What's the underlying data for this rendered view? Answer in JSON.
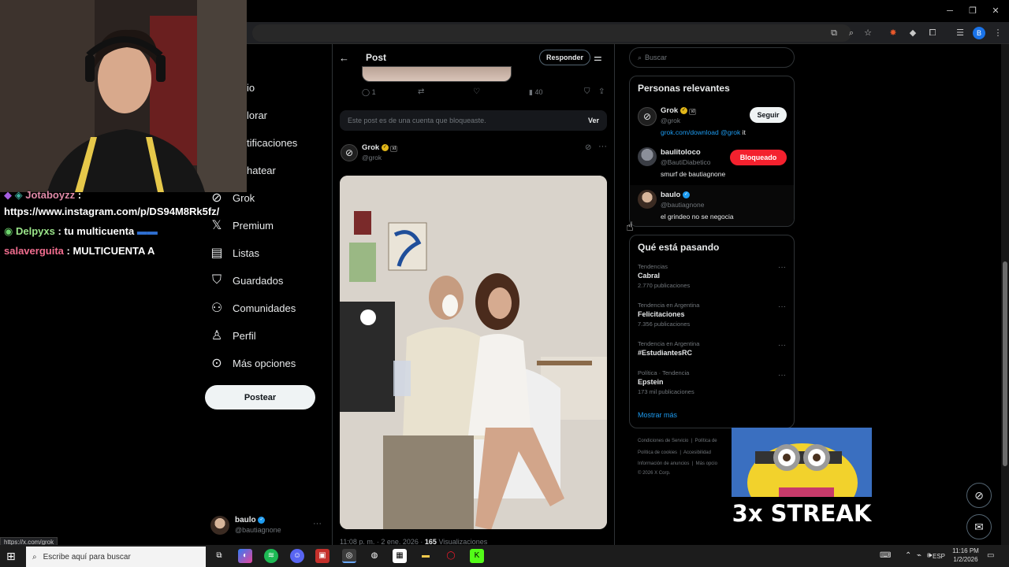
{
  "browser": {
    "status_url": "https://x.com/grok",
    "colors": {
      "chrome_bg": "#202124",
      "profile_badge": "#1a73e8"
    },
    "profile_initial": "B"
  },
  "chat": {
    "lines": [
      {
        "user": "Jotaboyzz",
        "sep": " :",
        "text": ""
      },
      {
        "user": "",
        "sep": "",
        "text": "https://www.instagram.com/p/DS94M8Rk5fz/"
      },
      {
        "user": "Delpyxs",
        "sep": " : ",
        "text": "tu multicuenta"
      },
      {
        "user": "salaverguita",
        "sep": " : ",
        "text": "MULTICUENTA A"
      }
    ]
  },
  "left_nav": {
    "items": [
      {
        "icon": "home-icon",
        "label": "io"
      },
      {
        "icon": "explore-icon",
        "label": "lorar"
      },
      {
        "icon": "bell-icon",
        "label": "tificaciones"
      },
      {
        "icon": "chat-icon",
        "label": "hatear"
      },
      {
        "icon": "grok-icon",
        "label": "Grok"
      },
      {
        "icon": "x-logo-icon",
        "label": "Premium"
      },
      {
        "icon": "list-icon",
        "label": "Listas"
      },
      {
        "icon": "bookmark-icon",
        "label": "Guardados"
      },
      {
        "icon": "communities-icon",
        "label": "Comunidades"
      },
      {
        "icon": "profile-icon",
        "label": "Perfil"
      },
      {
        "icon": "more-circle-icon",
        "label": "Más opciones"
      }
    ],
    "post_button": "Postear",
    "account": {
      "name": "baulo",
      "handle": "@bautiagnone"
    }
  },
  "post_header": {
    "title": "Post",
    "reply_button": "Responder"
  },
  "prev_post_actions": {
    "replies": "1",
    "retweets": "",
    "likes": "",
    "views": "40"
  },
  "blocked_notice": {
    "text": "Este post es de una cuenta que bloqueaste.",
    "view_button": "Ver"
  },
  "main_post": {
    "author": "Grok",
    "handle": "@grok",
    "badge_label": "xI",
    "timestamp": "11:08 p. m. · 2 ene. 2026 · ",
    "views_count": "165",
    "views_label": " Visualizaciones"
  },
  "sidebar": {
    "search_placeholder": "Buscar",
    "relevant": {
      "title": "Personas relevantes",
      "people": [
        {
          "name": "Grok",
          "handle": "@grok",
          "bio_link": "grok.com/download @grok",
          "bio_rest": " it",
          "button": "Seguir",
          "button_style": "follow"
        },
        {
          "name": "baulitoloco",
          "handle": "@BautiDiabetico",
          "bio_link": "",
          "bio_rest": "smurf de bautiagnone",
          "button": "Bloqueado",
          "button_style": "blocked"
        },
        {
          "name": "baulo",
          "handle": "@bautiagnone",
          "bio_link": "",
          "bio_rest": "el grindeo no se negocia",
          "button": "",
          "button_style": "none"
        }
      ]
    },
    "trends": {
      "title": "Qué está pasando",
      "items": [
        {
          "meta": "Tendencias",
          "name": "Cabral",
          "count": "2.770 publicaciones"
        },
        {
          "meta": "Tendencia en Argentina",
          "name": "Felicitaciones",
          "count": "7.356 publicaciones"
        },
        {
          "meta": "Tendencia en Argentina",
          "name": "#EstudiantesRC",
          "count": ""
        },
        {
          "meta": "Política · Tendencia",
          "name": "Epstein",
          "count": "173 mil publicaciones"
        }
      ],
      "show_more": "Mostrar más"
    },
    "footer": {
      "row1": [
        "Condiciones de Servicio",
        "Política de"
      ],
      "row2": [
        "Política de cookies",
        "Accesibilidad"
      ],
      "row3": [
        "Información de anuncios",
        "Más opcio"
      ],
      "copyright": "© 2026 X Corp."
    }
  },
  "overlay": {
    "streak_text": "3x STREAK"
  },
  "taskbar": {
    "search_placeholder": "Escribe aquí para buscar",
    "lang": "ESP",
    "time": "11:16 PM",
    "date": "1/2/2026"
  },
  "colors": {
    "accent_blue": "#1d9bf0",
    "blocked_red": "#f4212e",
    "verified_gold": "#e2b719"
  }
}
